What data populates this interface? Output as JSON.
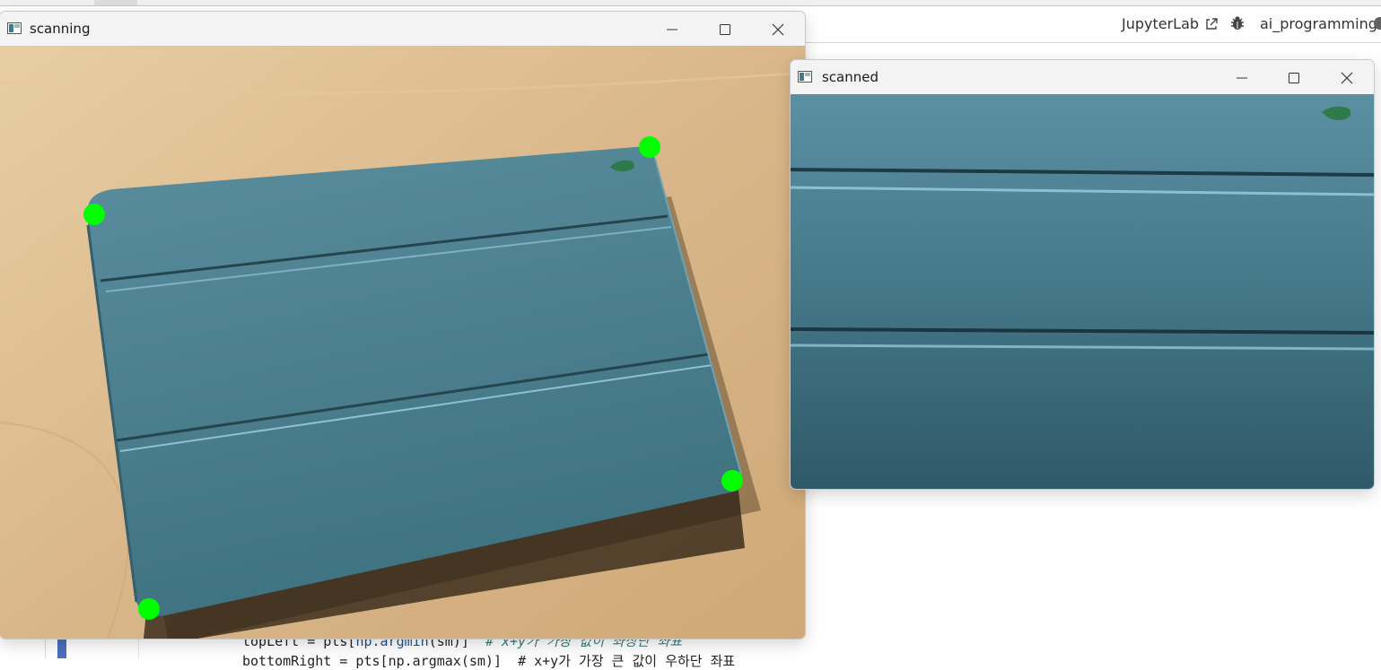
{
  "jupyter": {
    "link_label": "JupyterLab",
    "kernel_name": "ai_programming",
    "code_lines": [
      {
        "text_a": "topLeft = pts[",
        "fn": "np.argmin",
        "text_b": "(sm)]  ",
        "comment": "# x+y가 가장 값이 좌상단 좌표"
      },
      {
        "text": "bottomRight = pts[",
        "fn": "np.argmax",
        "text_b": "(sm)]  ",
        "comment": "# x+y가 가장 큰 값이 우하단 좌표"
      }
    ]
  },
  "windows": [
    {
      "id": "scanning",
      "title": "scanning",
      "controls": [
        "minimize-icon",
        "maximize-icon",
        "close-icon"
      ],
      "corner_markers": [
        {
          "label": "top-left"
        },
        {
          "label": "top-right"
        },
        {
          "label": "bottom-right"
        },
        {
          "label": "bottom-left"
        }
      ],
      "marker_color": "#00ff00"
    },
    {
      "id": "scanned",
      "title": "scanned",
      "controls": [
        "minimize-icon",
        "maximize-icon",
        "close-icon"
      ]
    }
  ],
  "colors": {
    "desk": "#d9b98f",
    "cover": "#4f8595",
    "cover_dark": "#2f5a68",
    "marker": "#00ff00"
  }
}
